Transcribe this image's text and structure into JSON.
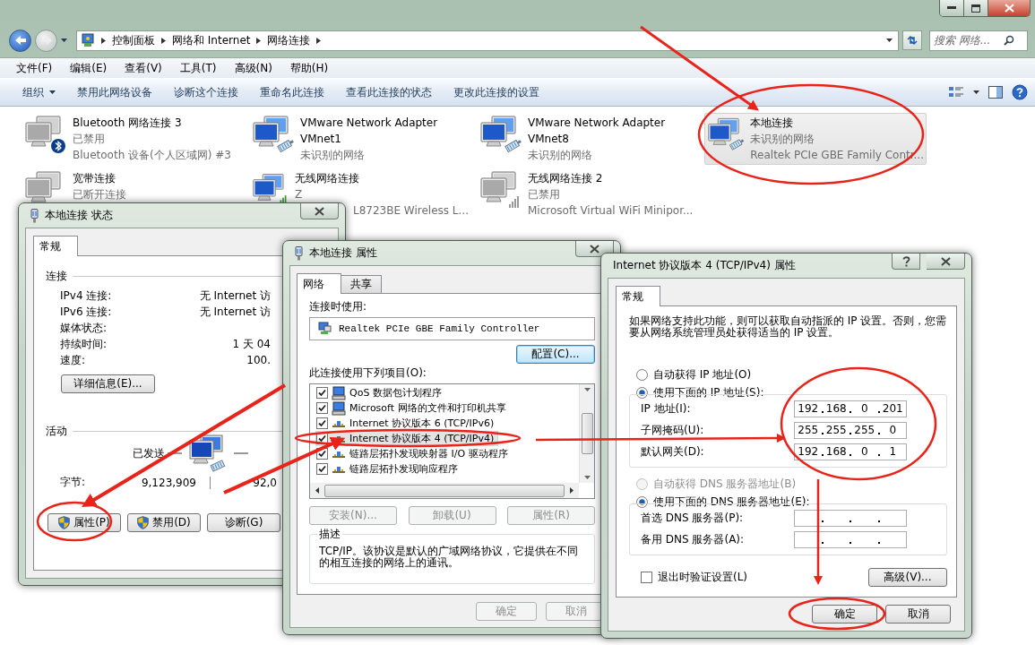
{
  "explorer": {
    "address": {
      "crumbs": [
        "控制面板",
        "网络和 Internet",
        "网络连接"
      ]
    },
    "search": {
      "placeholder": "搜索 网络..."
    },
    "menu": [
      "文件(F)",
      "编辑(E)",
      "查看(V)",
      "工具(T)",
      "高级(N)",
      "帮助(H)"
    ],
    "toolbar": {
      "organize": "组织",
      "commands": [
        "禁用此网络设备",
        "诊断这个连接",
        "重命名此连接",
        "查看此连接的状态",
        "更改此连接的设置"
      ]
    },
    "connections": [
      {
        "name": "Bluetooth 网络连接 3",
        "status": "已禁用",
        "device": "Bluetooth 设备(个人区域网) #3",
        "kind": "bluetooth",
        "disabled": true,
        "selected": false
      },
      {
        "name": "VMware Network Adapter VMnet1",
        "status": "未识别的网络",
        "kind": "wired",
        "disabled": false,
        "selected": false
      },
      {
        "name": "VMware Network Adapter VMnet8",
        "status": "未识别的网络",
        "kind": "wired",
        "disabled": false,
        "selected": false
      },
      {
        "name": "本地连接",
        "status": "未识别的网络",
        "device": "Realtek PCIe GBE Family Contr...",
        "kind": "wired",
        "disabled": false,
        "selected": true
      },
      {
        "name": "宽带连接",
        "status": "已断开连接",
        "kind": "broadband",
        "disabled": true,
        "selected": false
      },
      {
        "name": "无线网络连接",
        "status": "Z",
        "device": "L8723BE Wireless L...",
        "kind": "wireless",
        "disabled": false,
        "selected": false
      },
      {
        "name": "无线网络连接 2",
        "status": "已禁用",
        "device": "Microsoft Virtual WiFi Minipor...",
        "kind": "wireless",
        "disabled": true,
        "selected": false
      }
    ]
  },
  "status_dialog": {
    "title": "本地连接 状态",
    "tabs": [
      {
        "label": "常规",
        "selected": true
      }
    ],
    "connection_group": "连接",
    "rows": [
      {
        "label": "IPv4 连接:",
        "value": "无 Internet 访"
      },
      {
        "label": "IPv6 连接:",
        "value": "无 Internet 访"
      },
      {
        "label": "媒体状态:"
      },
      {
        "label": "持续时间:",
        "value": "1 天 04"
      },
      {
        "label": "速度:",
        "value": "100."
      }
    ],
    "details_button": "详细信息(E)...",
    "activity_group": "活动",
    "sent_label": "已发送",
    "bytes_label": "字节:",
    "bytes_sent": "9,123,909",
    "bytes_received": "92,0",
    "buttons": [
      {
        "label": "属性(P)",
        "shield": true
      },
      {
        "label": "禁用(D)",
        "shield": true
      },
      {
        "label": "诊断(G)",
        "shield": false
      }
    ]
  },
  "properties_dialog": {
    "title": "本地连接 属性",
    "tabs": [
      {
        "label": "网络",
        "selected": true
      },
      {
        "label": "共享",
        "selected": false
      }
    ],
    "connect_using_label": "连接时使用:",
    "adapter": "Realtek PCIe GBE Family Controller",
    "configure_button": "配置(C)...",
    "items_label": "此连接使用下列项目(O):",
    "items": [
      {
        "label": "QoS 数据包计划程序",
        "checked": true,
        "selected": false,
        "kind": "service"
      },
      {
        "label": "Microsoft 网络的文件和打印机共享",
        "checked": true,
        "selected": false,
        "kind": "service"
      },
      {
        "label": "Internet 协议版本 6 (TCP/IPv6)",
        "checked": true,
        "selected": false,
        "kind": "protocol"
      },
      {
        "label": "Internet 协议版本 4 (TCP/IPv4)",
        "checked": true,
        "selected": true,
        "kind": "protocol"
      },
      {
        "label": "链路层拓扑发现映射器 I/O 驱动程序",
        "checked": true,
        "selected": false,
        "kind": "protocol"
      },
      {
        "label": "链路层拓扑发现响应程序",
        "checked": true,
        "selected": false,
        "kind": "protocol"
      }
    ],
    "buttons": [
      {
        "label": "安装(N)...",
        "disabled": true
      },
      {
        "label": "卸载(U)",
        "disabled": true
      },
      {
        "label": "属性(R)",
        "disabled": true
      }
    ],
    "description_label": "描述",
    "description": "TCP/IP。该协议是默认的广域网络协议，它提供在不同的相互连接的网络上的通讯。",
    "footer": [
      {
        "label": "确定",
        "disabled": true
      },
      {
        "label": "取消",
        "disabled": true
      }
    ]
  },
  "ipv4_dialog": {
    "title": "Internet 协议版本 4 (TCP/IPv4) 属性",
    "tabs": [
      {
        "label": "常规",
        "selected": true
      }
    ],
    "intro": "如果网络支持此功能，则可以获取自动指派的 IP 设置。否则，您需要从网络系统管理员处获得适当的 IP 设置。",
    "ip_mode": [
      {
        "label": "自动获得 IP 地址(O)",
        "selected": false,
        "disabled": false
      },
      {
        "label": "使用下面的 IP 地址(S):",
        "selected": true,
        "disabled": false
      }
    ],
    "ip_fields": [
      {
        "label": "IP 地址(I):",
        "octets": [
          "192",
          "168",
          "0",
          "201"
        ]
      },
      {
        "label": "子网掩码(U):",
        "octets": [
          "255",
          "255",
          "255",
          "0"
        ]
      },
      {
        "label": "默认网关(D):",
        "octets": [
          "192",
          "168",
          "0",
          "1"
        ]
      }
    ],
    "dns_mode": [
      {
        "label": "自动获得 DNS 服务器地址(B)",
        "selected": false,
        "disabled": true
      },
      {
        "label": "使用下面的 DNS 服务器地址(E):",
        "selected": true,
        "disabled": false
      }
    ],
    "dns_fields": [
      {
        "label": "首选 DNS 服务器(P):"
      },
      {
        "label": "备用 DNS 服务器(A):"
      }
    ],
    "validate": {
      "label": "退出时验证设置(L)",
      "checked": false
    },
    "advanced_button": "高级(V)...",
    "footer": [
      {
        "label": "确定",
        "disabled": false
      },
      {
        "label": "取消",
        "disabled": false
      }
    ]
  }
}
